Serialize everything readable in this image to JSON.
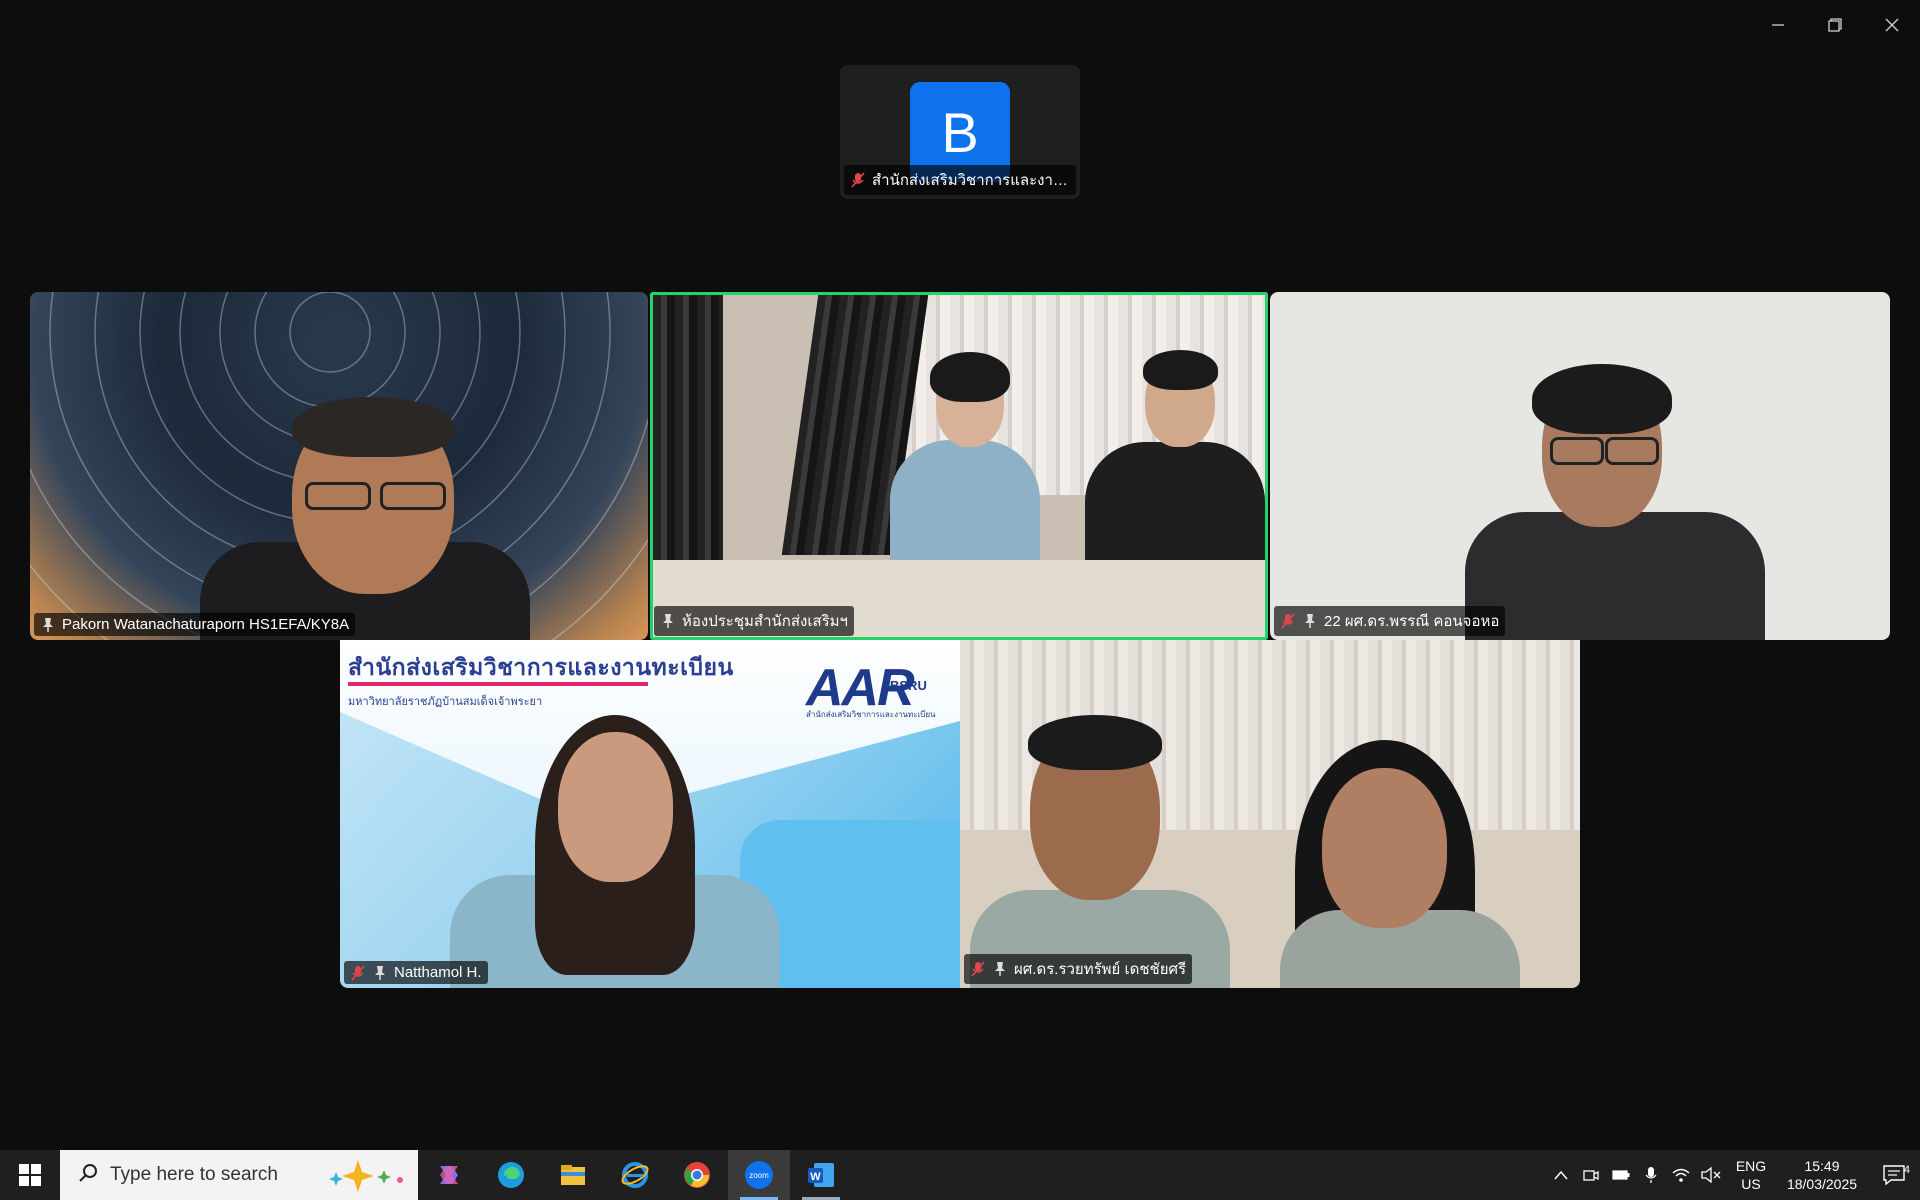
{
  "window": {
    "controls": [
      "minimize-icon",
      "restore-icon",
      "close-icon"
    ]
  },
  "top_participant": {
    "initial": "B",
    "name": "สำนักส่งเสริมวิชาการและงานทะเบี...",
    "muted": true,
    "avatar_color": "#0e72ed"
  },
  "participants": [
    {
      "name": "Pakorn Watanachaturaporn HS1EFA/KY8A",
      "muted": false,
      "pinned": true
    },
    {
      "name": "ห้องประชุมสำนักส่งเสริมฯ",
      "muted": false,
      "pinned": true,
      "active_speaker": true
    },
    {
      "name": "22 ผศ.ดร.พรรณี คอนจอหอ",
      "muted": true,
      "pinned": true
    },
    {
      "name": "Natthamol H.",
      "muted": true,
      "pinned": true
    },
    {
      "name": "ผศ.ดร.รวยทรัพย์ เดชชัยศรี",
      "muted": true,
      "pinned": true
    }
  ],
  "banner": {
    "title": "สำนักส่งเสริมวิชาการและงานทะเบียน",
    "subtitle": "มหาวิทยาลัยราชภัฏบ้านสมเด็จเจ้าพระยา",
    "logo": "AAR",
    "logo_sub": "BSRU",
    "logo_caption": "สำนักส่งเสริมวิชาการและงานทะเบียน"
  },
  "taskbar": {
    "search_placeholder": "Type here to search",
    "apps": [
      "copilot-icon",
      "edge-icon",
      "file-explorer-icon",
      "internet-explorer-icon",
      "chrome-icon",
      "zoom-icon",
      "word-icon"
    ],
    "active_app": "zoom-icon",
    "lang_line1": "ENG",
    "lang_line2": "US",
    "time": "15:49",
    "date": "18/03/2025",
    "notifications": "4"
  },
  "colors": {
    "active_speaker_border": "#22d36a",
    "muted_icon": "#e0474c",
    "zoom_blue": "#0e72ed"
  }
}
